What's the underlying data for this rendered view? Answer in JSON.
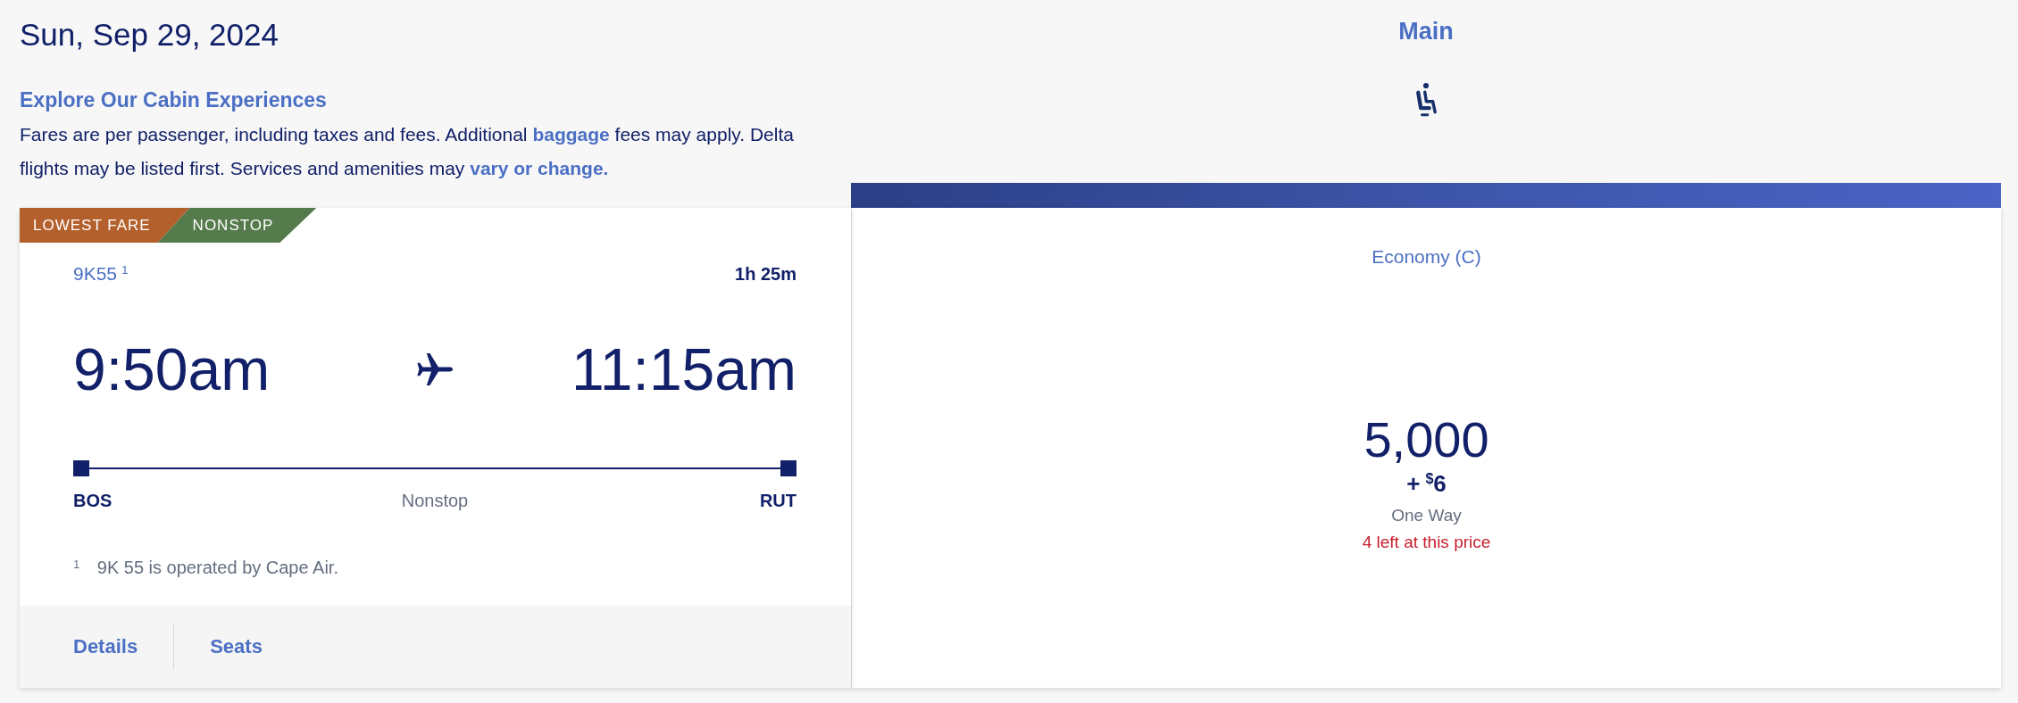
{
  "date": "Sun, Sep 29, 2024",
  "intro": {
    "heading": "Explore Our Cabin Experiences",
    "segments": [
      {
        "kind": "text",
        "text": "Fares are per passenger, including taxes and fees. Additional "
      },
      {
        "kind": "link",
        "text": "baggage"
      },
      {
        "kind": "text",
        "text": " fees may apply. Delta flights may be listed first. Services and amenities may "
      },
      {
        "kind": "link",
        "text": "vary or change."
      }
    ]
  },
  "cabin": {
    "title": "Main"
  },
  "flight": {
    "tags": [
      {
        "label": "LOWEST FARE",
        "color": "#b3602d"
      },
      {
        "label": "NONSTOP",
        "color": "#557a4b"
      }
    ],
    "flight_number": "9K55$^{1}$",
    "duration": "1h 25m",
    "depart_time": "9:50am",
    "arrive_time": "11:15am",
    "origin": "BOS",
    "stops": "Nonstop",
    "destination": "RUT",
    "footnote": "$^{1}$ 9K 55 is operated by Cape Air.",
    "actions": [
      {
        "label": "Details"
      },
      {
        "label": "Seats"
      }
    ]
  },
  "fare": {
    "cabin_class": "Economy (C)",
    "miles": "5,000",
    "fee": {
      "sign": "+",
      "currency": "$",
      "amount": "6"
    },
    "trip_type": "One Way",
    "availability": "4 left at this price"
  }
}
